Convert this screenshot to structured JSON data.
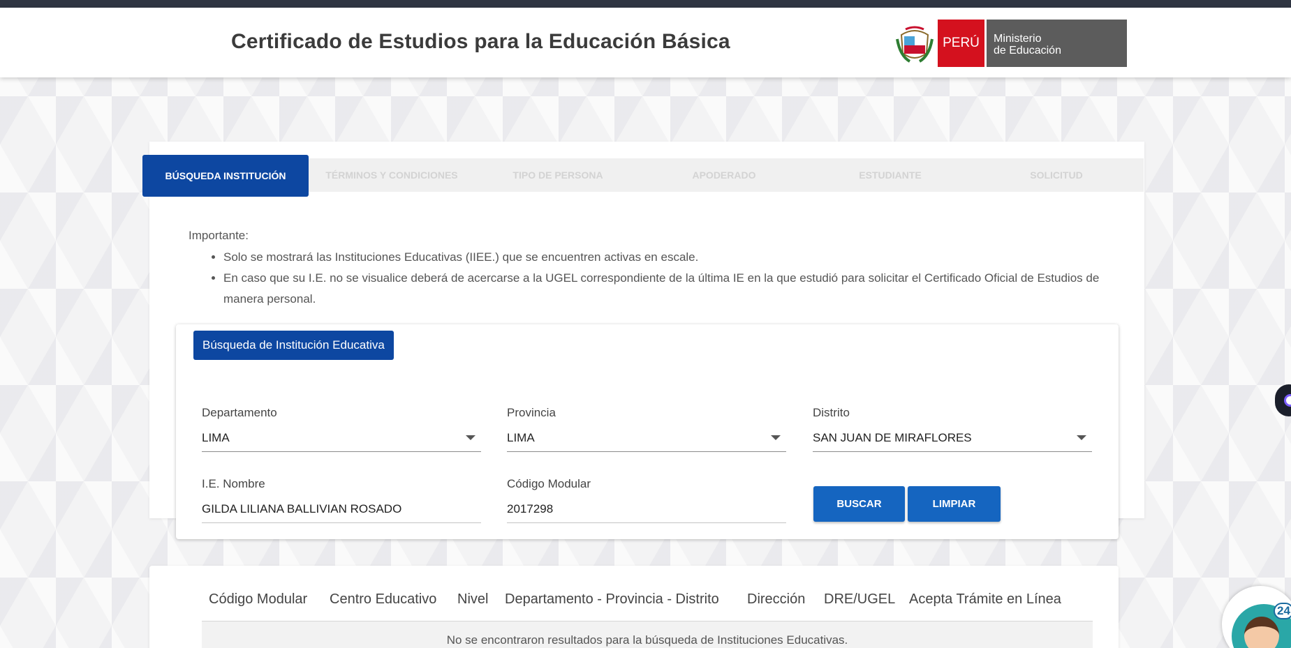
{
  "header": {
    "title": "Certificado de Estudios para la Educación Básica",
    "logo_country": "PERÚ",
    "logo_ministry_line1": "Ministerio",
    "logo_ministry_line2": "de Educación"
  },
  "steps": [
    {
      "label": "BÚSQUEDA INSTITUCIÓN",
      "active": true
    },
    {
      "label": "TÉRMINOS Y CONDICIONES",
      "active": false
    },
    {
      "label": "TIPO DE PERSONA",
      "active": false
    },
    {
      "label": "APODERADO",
      "active": false
    },
    {
      "label": "ESTUDIANTE",
      "active": false
    },
    {
      "label": "SOLICITUD",
      "active": false
    }
  ],
  "notice": {
    "heading": "Importante:",
    "items": [
      "Solo se mostrará las Instituciones Educativas (IIEE.) que se encuentren activas en escale.",
      "En caso que su I.E. no se visualice deberá de acercarse a la UGEL correspondiente de la última IE en la que estudió para solicitar el Certificado Oficial de Estudios de manera personal."
    ]
  },
  "search": {
    "section_label": "Búsqueda de Institución Educativa",
    "departamento": {
      "label": "Departamento",
      "value": "LIMA"
    },
    "provincia": {
      "label": "Provincia",
      "value": "LIMA"
    },
    "distrito": {
      "label": "Distrito",
      "value": "SAN JUAN DE MIRAFLORES"
    },
    "ie_nombre": {
      "label": "I.E. Nombre",
      "value": "GILDA LILIANA BALLIVIAN ROSADO"
    },
    "codigo_modular": {
      "label": "Código Modular",
      "value": "2017298"
    },
    "buscar_label": "BUSCAR",
    "limpiar_label": "LIMPIAR"
  },
  "results": {
    "columns": [
      "Código Modular",
      "Centro Educativo",
      "Nivel",
      "Departamento - Provincia - Distrito",
      "Dirección",
      "DRE/UGEL",
      "Acepta Trámite en Línea"
    ],
    "empty_message": "No se encontraron resultados para la búsqueda de Instituciones Educativas."
  },
  "chat_widget": {
    "badge": "24"
  },
  "colors": {
    "primary": "#0d47a1",
    "button": "#1565c0",
    "peru_red": "#d4111e",
    "ministry_gray": "#5c5c5c"
  },
  "icons": [
    "peru-coat-of-arms-icon",
    "dropdown-caret-icon",
    "accessibility-eye-icon",
    "chat-assistant-icon"
  ]
}
